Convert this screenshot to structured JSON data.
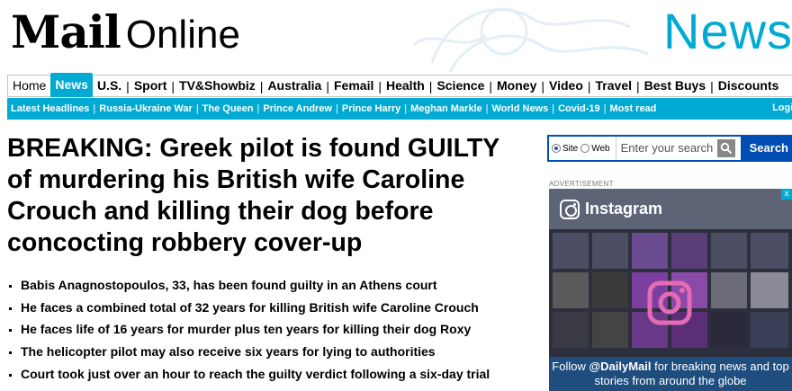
{
  "brand": {
    "mail": "Mail",
    "online": "Online",
    "section": "News"
  },
  "nav_primary": [
    {
      "label": "Home",
      "active": false
    },
    {
      "label": "News",
      "active": true
    },
    {
      "label": "U.S.",
      "active": false
    },
    {
      "label": "Sport",
      "active": false
    },
    {
      "label": "TV&Showbiz",
      "active": false
    },
    {
      "label": "Australia",
      "active": false
    },
    {
      "label": "Femail",
      "active": false
    },
    {
      "label": "Health",
      "active": false
    },
    {
      "label": "Science",
      "active": false
    },
    {
      "label": "Money",
      "active": false
    },
    {
      "label": "Video",
      "active": false
    },
    {
      "label": "Travel",
      "active": false
    },
    {
      "label": "Best Buys",
      "active": false
    },
    {
      "label": "Discounts",
      "active": false
    }
  ],
  "nav_secondary": [
    "Latest Headlines",
    "Russia-Ukraine War",
    "The Queen",
    "Prince Andrew",
    "Prince Harry",
    "Meghan Markle",
    "World News",
    "Covid-19",
    "Most read"
  ],
  "nav_login": "Login",
  "article": {
    "headline": "BREAKING: Greek pilot is found GUILTY of murdering his British wife Caroline Crouch and killing their dog before concocting robbery cover-up",
    "bullets": [
      "Babis Anagnostopoulos, 33, has been found guilty in an Athens court",
      "He faces a combined total of 32 years for killing British wife Caroline Crouch",
      "He faces life of 16 years for murder plus ten years for killing their dog Roxy",
      "The helicopter pilot may also receive six years for lying to authorities",
      "Court took just over an hour to reach the guilty verdict following a six-day trial"
    ]
  },
  "search": {
    "option_site": "Site",
    "option_web": "Web",
    "selected": "Site",
    "placeholder": "Enter your search",
    "button": "Search"
  },
  "ad": {
    "label": "ADVERTISEMENT",
    "platform": "Instagram",
    "footer_pre": "Follow ",
    "footer_handle": "@DailyMail",
    "footer_post": " for breaking news and top stories from around the globe",
    "close": "x"
  },
  "colors": {
    "accent": "#00aad2",
    "search_blue": "#004DB3"
  }
}
